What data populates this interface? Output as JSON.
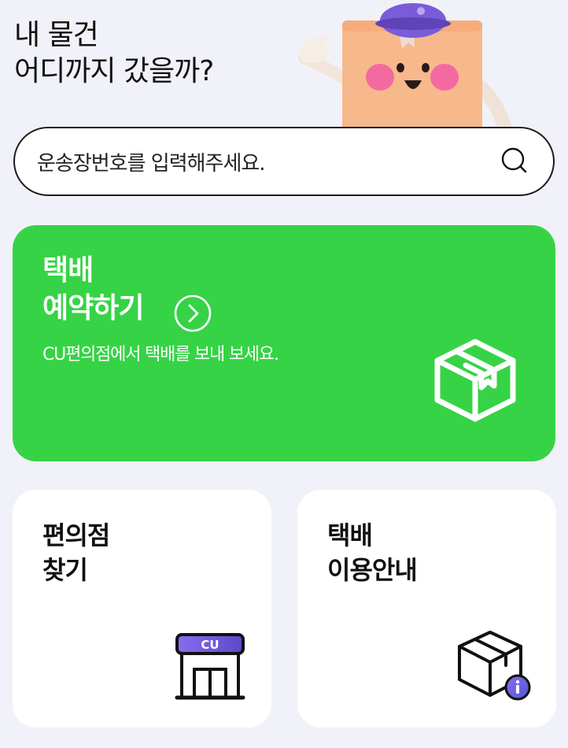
{
  "header": {
    "line1": "내 물건",
    "line2": "어디까지 갔을까?"
  },
  "search": {
    "placeholder": "운송장번호를 입력해주세요."
  },
  "reserve": {
    "title_line1": "택배",
    "title_line2": "예약하기",
    "subtitle": "CU편의점에서 택배를 보내 보세요."
  },
  "store_card": {
    "title_line1": "편의점",
    "title_line2": "찾기",
    "sign_text": "CU"
  },
  "guide_card": {
    "title_line1": "택배",
    "title_line2": "이용안내"
  },
  "colors": {
    "background": "#f1f2f9",
    "accent_green": "#36d346",
    "brand_purple": "#7a5cd8",
    "mascot_body": "#f7b98c",
    "text": "#111111"
  },
  "icons": {
    "search": "search-icon",
    "arrow": "chevron-right-circle-icon",
    "box": "box-icon",
    "store": "store-icon",
    "info_box": "info-box-icon"
  }
}
